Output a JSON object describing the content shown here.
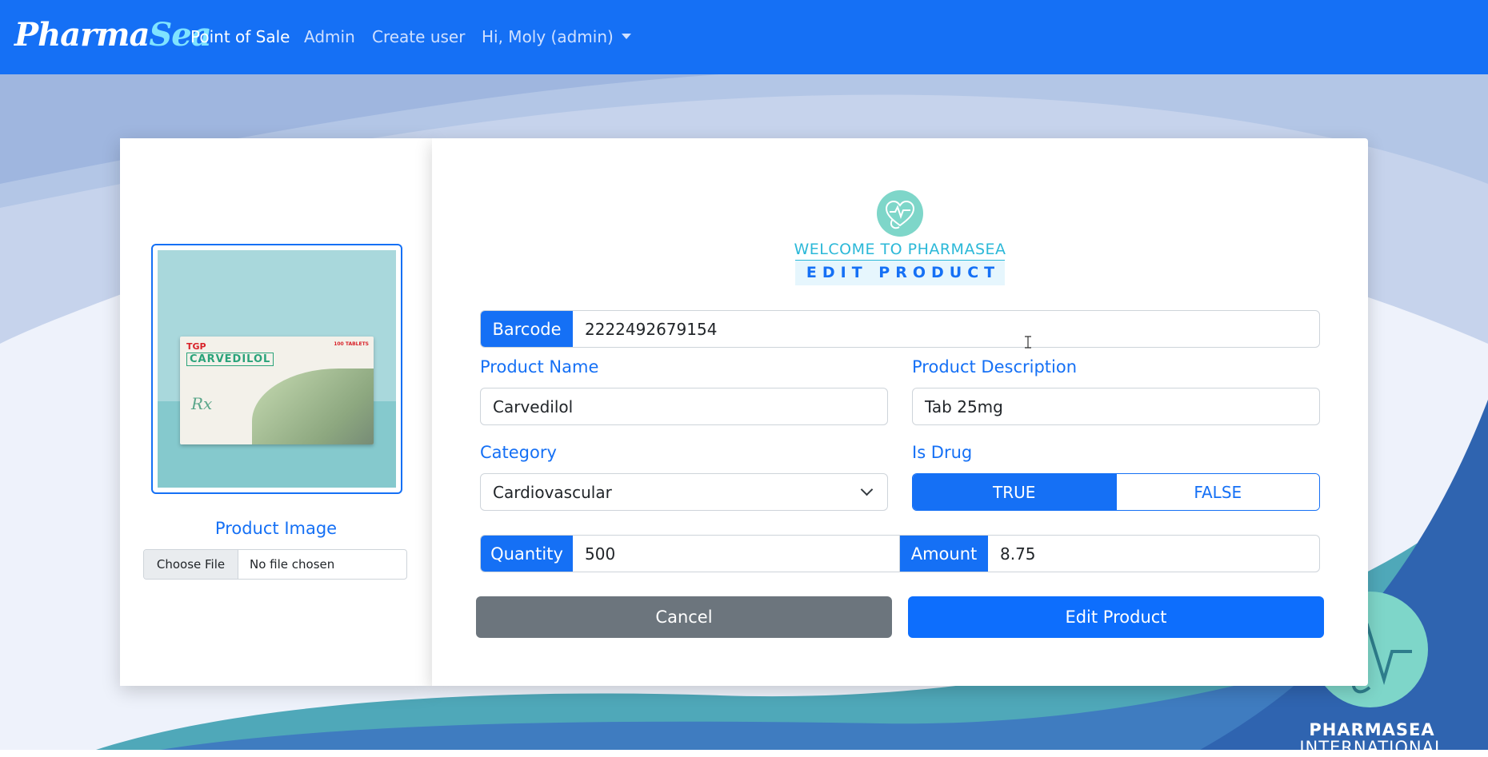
{
  "nav": {
    "brand_part1": "Pharma",
    "brand_part2": "Sea",
    "links": [
      "Point of Sale",
      "Admin",
      "Create user"
    ],
    "user_menu": "Hi, Moly (admin)"
  },
  "image_panel": {
    "box_brand": "TGP",
    "box_name": "CARVEDILOL",
    "box_count": "100 TABLETS",
    "box_rx": "Rx",
    "label": "Product Image",
    "choose_file": "Choose File",
    "file_status": "No file chosen"
  },
  "form": {
    "welcome": "WELCOME TO PHARMASEA",
    "title": "EDIT PRODUCT",
    "barcode_label": "Barcode",
    "barcode_value": "2222492679154",
    "product_name_label": "Product Name",
    "product_name_value": "Carvedilol",
    "description_label": "Product Description",
    "description_value": "Tab 25mg",
    "category_label": "Category",
    "category_value": "Cardiovascular",
    "is_drug_label": "Is Drug",
    "is_drug_true": "TRUE",
    "is_drug_false": "FALSE",
    "quantity_label": "Quantity",
    "quantity_value": "500",
    "amount_label": "Amount",
    "amount_value": "8.75",
    "cancel_button": "Cancel",
    "submit_button": "Edit Product"
  },
  "footer_brand": {
    "line1": "PHARMASEA",
    "line2": "INTERNATIONAL"
  },
  "colors": {
    "primary": "#1570f5",
    "secondary": "#6c757d",
    "teal": "#7ed6c9"
  }
}
